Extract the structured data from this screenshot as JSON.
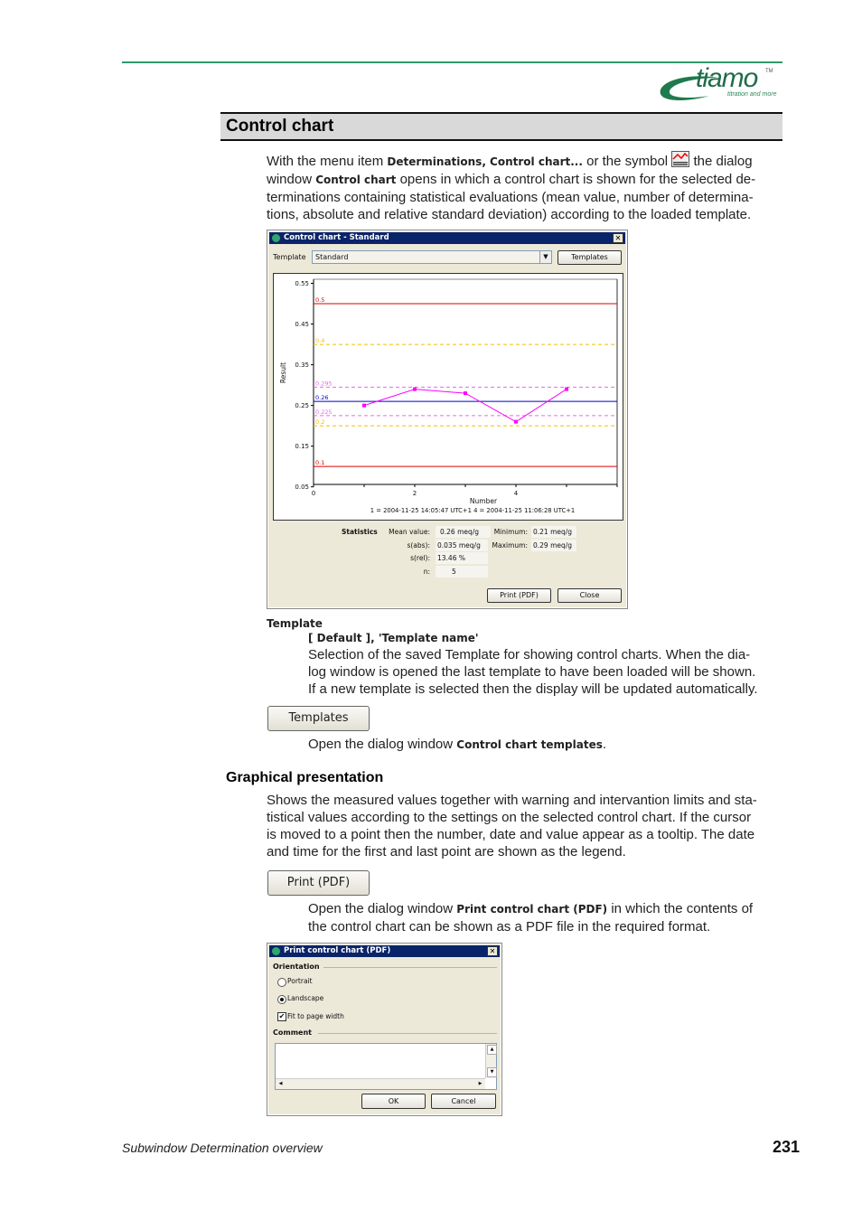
{
  "header": {
    "logo": {
      "wordmark": "tiamo",
      "trademark": "TM",
      "tagline": "titration and more"
    },
    "accent_color": "#2e9a6a"
  },
  "section": {
    "title": "Control chart"
  },
  "intro": {
    "t1": "With the menu item ",
    "b1": "Determinations, Control chart...",
    "t2": " or the symbol ",
    "icon": "control-chart-icon",
    "t3": " the dialog",
    "t4": "window ",
    "b2": "Control chart",
    "t5": " opens in which a control chart is shown for the selected de-",
    "line3": "terminations containing statistical evaluations (mean value, number of determina-",
    "line4": "tions, absolute and relative standard deviation) according to the loaded template."
  },
  "control_dialog": {
    "title": "Control chart - Standard",
    "template_label": "Template",
    "template_value": "Standard",
    "templates_button": "Templates",
    "print_button": "Print (PDF)",
    "close_button": "Close",
    "statistics": {
      "heading": "Statistics",
      "mean_label": "Mean value:",
      "mean_value": "0.26 meq/g",
      "sabs_label": "s(abs):",
      "sabs_value": "0.035 meq/g",
      "srel_label": "s(rel):",
      "srel_value": "13.46 %",
      "n_label": "n:",
      "n_value": "5",
      "min_label": "Minimum:",
      "min_value": "0.21 meq/g",
      "max_label": "Maximum:",
      "max_value": "0.29 meq/g"
    }
  },
  "chart_data": {
    "type": "line",
    "title": "",
    "xlabel": "Number",
    "ylabel": "Result",
    "xlim": [
      0,
      6
    ],
    "ylim": [
      0.056,
      0.56
    ],
    "x_ticks": [
      0,
      2,
      4
    ],
    "x_minor_ticks": [
      1,
      3,
      5,
      6
    ],
    "y_ticks": [
      0.05,
      0.15,
      0.25,
      0.35,
      0.45,
      0.55
    ],
    "y_tick_labels": [
      "0.05",
      "0.15",
      "0.25",
      "0.35",
      "0.45",
      "0.55"
    ],
    "grid": false,
    "series": [
      {
        "name": "Result",
        "color": "#ff00ff",
        "x": [
          1,
          2,
          3,
          4,
          5
        ],
        "y": [
          0.25,
          0.29,
          0.28,
          0.21,
          0.29
        ]
      }
    ],
    "limit_lines": [
      {
        "label": "0.5",
        "value": 0.5,
        "color": "#dd0000",
        "style": "solid",
        "kind": "upper intervention limit"
      },
      {
        "label": "0.4",
        "value": 0.4,
        "color": "#f0c000",
        "style": "dashed",
        "kind": "upper warning limit"
      },
      {
        "label": "0.295",
        "value": 0.295,
        "color": "#ee66ee",
        "style": "dashed",
        "kind": "upper s limit"
      },
      {
        "label": "0.26",
        "value": 0.26,
        "color": "#0000cc",
        "style": "solid",
        "kind": "mean"
      },
      {
        "label": "0.225",
        "value": 0.225,
        "color": "#ee66ee",
        "style": "dashed",
        "kind": "lower s limit"
      },
      {
        "label": "0.2",
        "value": 0.2,
        "color": "#f0c000",
        "style": "dashed",
        "kind": "lower warning limit"
      },
      {
        "label": "0.1",
        "value": 0.1,
        "color": "#dd0000",
        "style": "solid",
        "kind": "lower intervention limit"
      }
    ],
    "legend": "1 = 2004-11-25 14:05:47 UTC+1     4 = 2004-11-25 11:06:28 UTC+1",
    "legend_placement": "bottom"
  },
  "template_param": {
    "heading": "Template",
    "values": "[ Default ], 'Template name'",
    "desc1": "Selection of the saved Template for showing control charts. When the dia-",
    "desc2": "log window is opened the last template to have been loaded will be shown.",
    "desc3": "If a new template is selected then the display will be updated automatically."
  },
  "templates_button_doc": {
    "label": "Templates",
    "desc_pre": "Open the dialog window ",
    "desc_bold": "Control chart templates",
    "desc_post": "."
  },
  "graphical": {
    "heading": "Graphical presentation",
    "l1": "Shows the measured values together with warning and intervantion limits and sta-",
    "l2": "tistical values according to the settings on the selected control chart. If the cursor",
    "l3": "is moved to a point then the number, date and value appear as a tooltip. The date",
    "l4": "and time for the first and last point are shown as the legend."
  },
  "print_button_doc": {
    "label": "Print (PDF)",
    "desc_pre": "Open the dialog window ",
    "desc_bold": "Print control chart (PDF)",
    "desc_post": " in which the contents of",
    "desc2": "the control chart can be shown as a PDF file in the required format."
  },
  "print_dialog": {
    "title": "Print control chart (PDF)",
    "orientation_label": "Orientation",
    "portrait": "Portrait",
    "landscape": "Landscape",
    "orientation_selected": "Landscape",
    "fit_label": "Fit to page width",
    "fit_checked": true,
    "comment_label": "Comment",
    "comment_value": "",
    "ok": "OK",
    "cancel": "Cancel"
  },
  "footer": {
    "chapter": "Subwindow Determination overview",
    "page": "231"
  }
}
